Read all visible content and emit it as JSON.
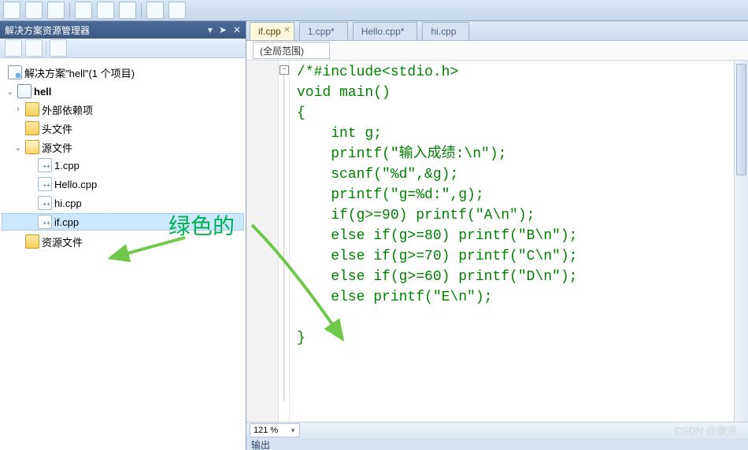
{
  "toolbar_icons": [
    "new",
    "open",
    "save",
    "undo",
    "redo",
    "cut",
    "copy",
    "paste",
    "sep",
    "run",
    "stop"
  ],
  "solution_explorer": {
    "title": "解决方案资源管理器",
    "pin_icon": "pin-icon",
    "close_icon": "close-icon",
    "toolbar_icons": [
      "refresh",
      "sync",
      "properties"
    ],
    "solution_label": "解决方案\"hell\"(1 个项目)",
    "tree": {
      "project": "hell",
      "folders": [
        {
          "name": "外部依赖项",
          "icon": "folder",
          "children": []
        },
        {
          "name": "头文件",
          "icon": "folder",
          "children": []
        },
        {
          "name": "源文件",
          "icon": "folder-open",
          "children": [
            {
              "name": "1.cpp"
            },
            {
              "name": "Hello.cpp"
            },
            {
              "name": "hi.cpp"
            },
            {
              "name": "if.cpp",
              "selected": true
            }
          ]
        },
        {
          "name": "资源文件",
          "icon": "folder",
          "children": []
        }
      ]
    },
    "bottom_tab": "输出"
  },
  "editor": {
    "tabs": [
      {
        "label": "if.cpp",
        "active": true,
        "close": true
      },
      {
        "label": "1.cpp*",
        "active": false
      },
      {
        "label": "Hello.cpp*",
        "active": false
      },
      {
        "label": "hi.cpp",
        "active": false
      }
    ],
    "scope": "(全局范围)",
    "fold_glyph": "−",
    "code_lines": [
      "/*#include<stdio.h>",
      "void main()",
      "{",
      "    int g;",
      "    printf(\"输入成绩:\\n\");",
      "    scanf(\"%d\",&g);",
      "    printf(\"g=%d:\",g);",
      "    if(g>=90) printf(\"A\\n\");",
      "    else if(g>=80) printf(\"B\\n\");",
      "    else if(g>=70) printf(\"C\\n\");",
      "    else if(g>=60) printf(\"D\\n\");",
      "    else printf(\"E\\n\");",
      "",
      "}"
    ],
    "zoom": "121 %",
    "output_label": "输出"
  },
  "annotation": {
    "text": "绿色的"
  },
  "watermark": "CSDN @康贤"
}
